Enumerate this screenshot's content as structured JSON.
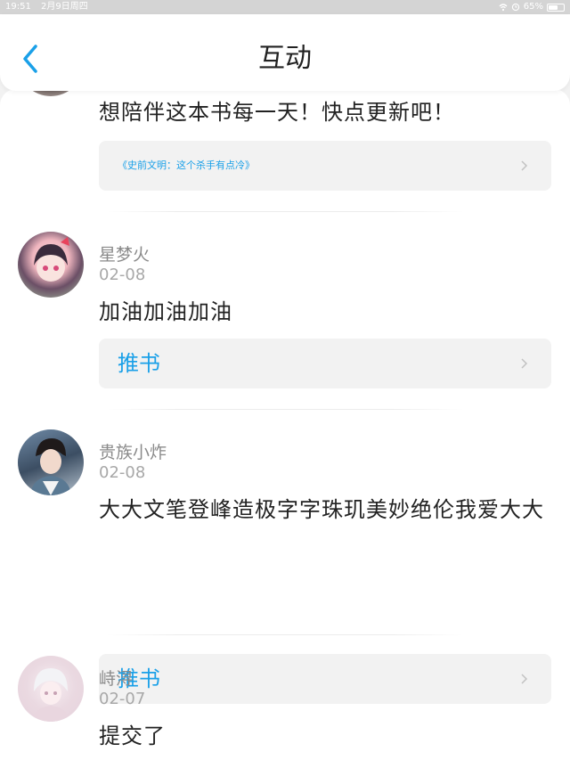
{
  "status_bar": {
    "time": "19:51",
    "date": "2月9日周四",
    "battery": "65%",
    "battery_level": 0.65
  },
  "nav": {
    "title": "互动"
  },
  "comments": [
    {
      "text": "想陪伴这本书每一天！快点更新吧！",
      "card_label": "《史前文明：这个杀手有点冷》"
    },
    {
      "name": "星梦火",
      "date": "02-08",
      "text": "加油加油加油",
      "card_label": "推书"
    },
    {
      "name": "贵族小炸",
      "date": "02-08",
      "text": "大大文笔登峰造极字字珠玑美妙绝伦我爱大大",
      "card_label": "推书"
    },
    {
      "name": "峙浔",
      "date": "02-07",
      "text": "提交了"
    }
  ],
  "colors": {
    "accent": "#1aa0e8",
    "text": "#222222",
    "meta": "#8a8a8a",
    "card_bg": "#f2f2f2"
  }
}
